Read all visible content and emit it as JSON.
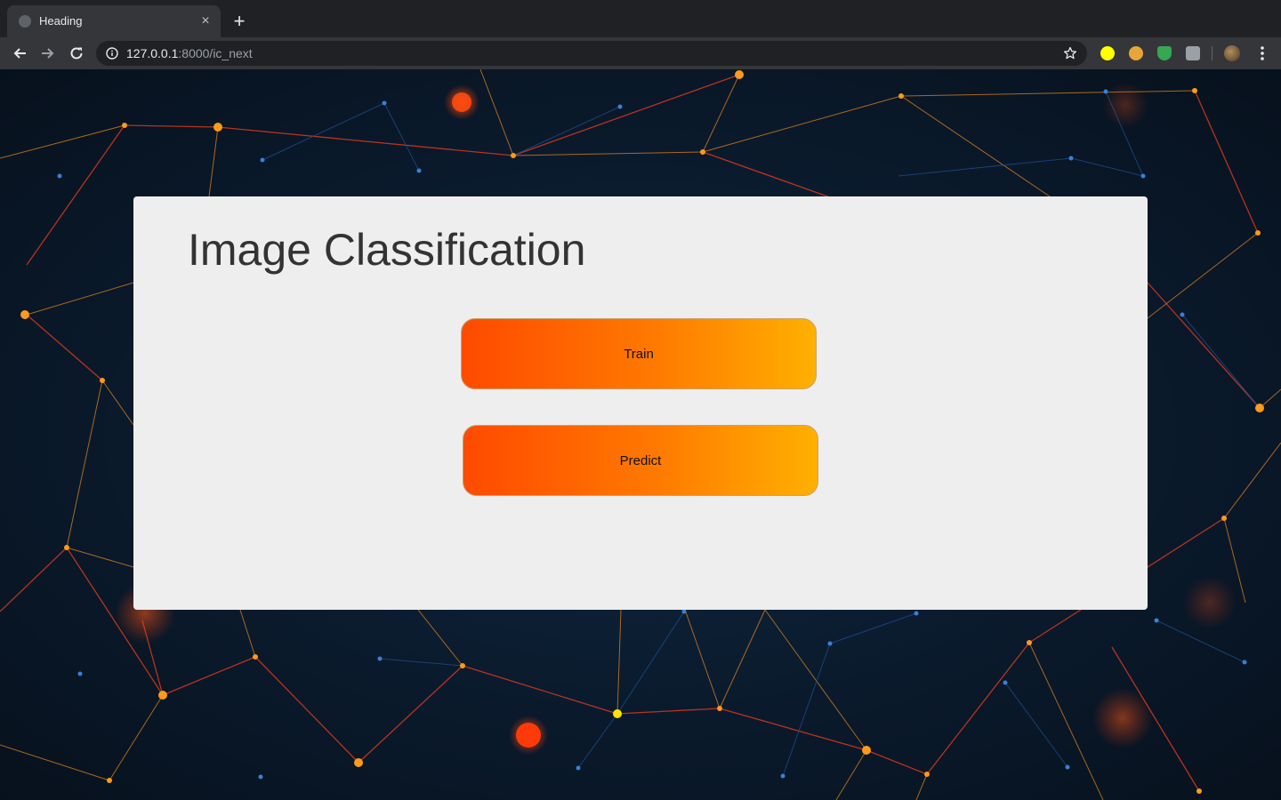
{
  "browser": {
    "tab": {
      "title": "Heading",
      "close_glyph": "×"
    },
    "new_tab_glyph": "+",
    "address_bar": {
      "host": "127.0.0.1",
      "rest": ":8000/ic_next"
    },
    "icons": {
      "back": "arrow-left-icon",
      "forward": "arrow-right-icon",
      "reload": "reload-icon",
      "info": "info-icon",
      "bookmark": "star-icon",
      "menu": "kebab-menu-icon"
    },
    "extension_colors": [
      "#ffff00",
      "#e8a53a",
      "#34a853",
      "#9aa0a6"
    ]
  },
  "page": {
    "heading": "Image Classification",
    "buttons": {
      "train": "Train",
      "predict": "Predict"
    },
    "colors": {
      "card": "#eeeeee",
      "heading": "#333333",
      "button_gradient_start": "#ff4a00",
      "button_gradient_end": "#ffb000",
      "background": "#0a1a2c"
    }
  }
}
